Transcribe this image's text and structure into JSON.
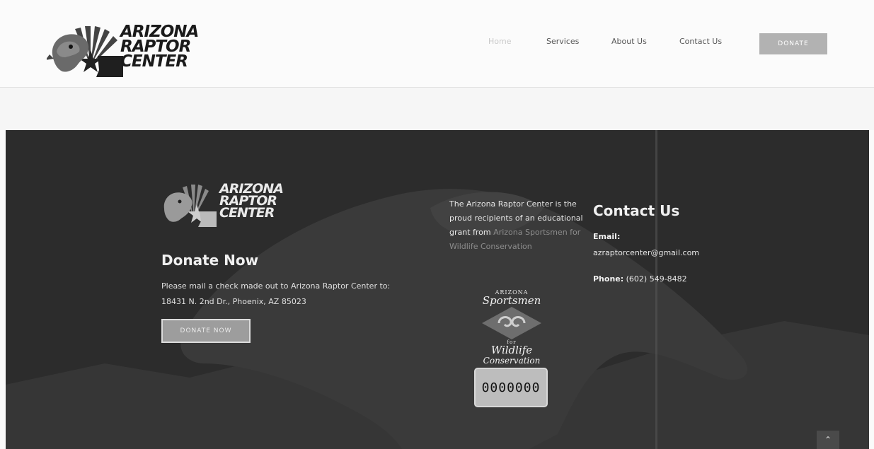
{
  "header": {
    "logo": {
      "line1": "ARIZONA",
      "line2": "RAPTOR",
      "line3": "CENTER"
    },
    "nav": [
      {
        "label": "Home",
        "active": true
      },
      {
        "label": "Services",
        "active": false
      },
      {
        "label": "About Us",
        "active": false
      },
      {
        "label": "Contact Us",
        "active": false
      }
    ],
    "donate_label": "DONATE"
  },
  "footer": {
    "logo": {
      "line1": "ARIZONA",
      "line2": "RAPTOR",
      "line3": "CENTER"
    },
    "donate": {
      "title": "Donate Now",
      "line1": "Please mail a check made out to Arizona Raptor Center to:",
      "line2": "18431 N. 2nd Dr., Phoenix, AZ 85023",
      "button": "DONATE NOW"
    },
    "grant": {
      "text": "The Arizona Raptor Center is the proud recipients of an educational grant from",
      "link": "Arizona Sportsmen for Wildlife Conservation",
      "badge": {
        "top": "ARIZONA",
        "script1": "Sportsmen",
        "for": "for",
        "script2": "Wildlife",
        "script3": "Conservation",
        "plate_number": "0000000"
      }
    },
    "contact": {
      "title": "Contact Us",
      "email_label": "Email:",
      "email": "azraptorcenter@gmail.com",
      "phone_label": "Phone:",
      "phone": "(602) 549-8482"
    },
    "scroll_top_icon": "chevron-up-icon"
  },
  "colors": {
    "footer_bg": "#2f2f2f",
    "donate_button": "#b2b2b2",
    "nav_text": "#555555"
  }
}
